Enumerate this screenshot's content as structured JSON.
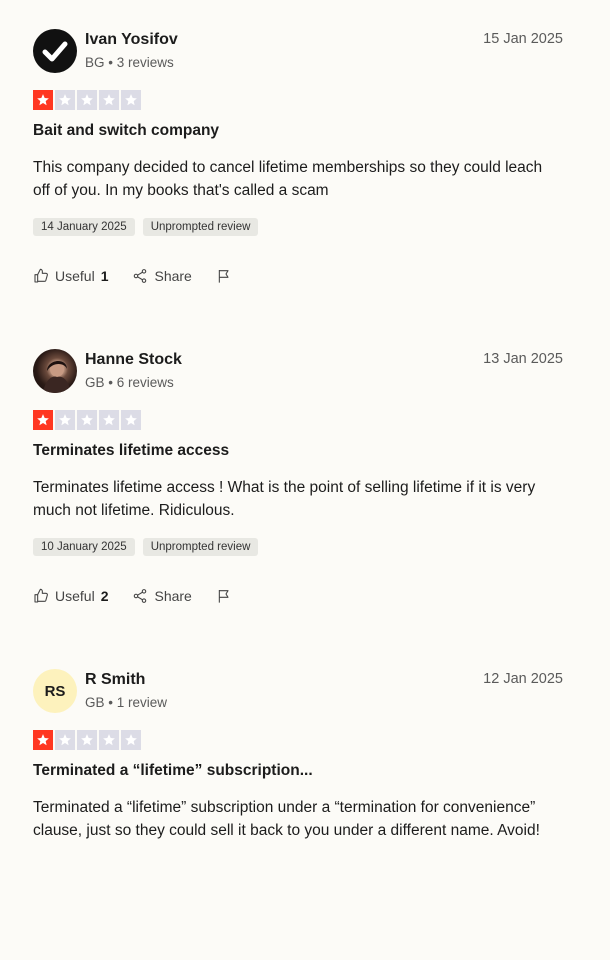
{
  "reviews": [
    {
      "avatar": "check-icon",
      "name": "Ivan Yosifov",
      "meta": "BG • 3 reviews",
      "date": "15 Jan 2025",
      "rating": 1,
      "title": "Bait and switch company",
      "body": "This company decided to cancel lifetime memberships so they could leach off of you. In my books that's called a scam",
      "tag_date": "14 January 2025",
      "tag_type": "Unprompted review",
      "useful_label": "Useful",
      "useful_count": "1",
      "share_label": "Share"
    },
    {
      "avatar": "photo",
      "name": "Hanne Stock",
      "meta": "GB • 6 reviews",
      "date": "13 Jan 2025",
      "rating": 1,
      "title": "Terminates lifetime access",
      "body": "Terminates lifetime access ! What is the point of selling lifetime if it is very much not lifetime. Ridiculous.",
      "tag_date": "10 January 2025",
      "tag_type": "Unprompted review",
      "useful_label": "Useful",
      "useful_count": "2",
      "share_label": "Share"
    },
    {
      "avatar_initials": "RS",
      "name": "R Smith",
      "meta": "GB • 1 review",
      "date": "12 Jan 2025",
      "rating": 1,
      "title": "Terminated a “lifetime” subscription...",
      "body": "Terminated a “lifetime” subscription under a “termination for convenience” clause, just so they could sell it back to you under a different name. Avoid!"
    }
  ],
  "colors": {
    "star_on": "#ff3722",
    "star_off": "#dcdce6",
    "initials_bg": "#fdf2bd"
  }
}
